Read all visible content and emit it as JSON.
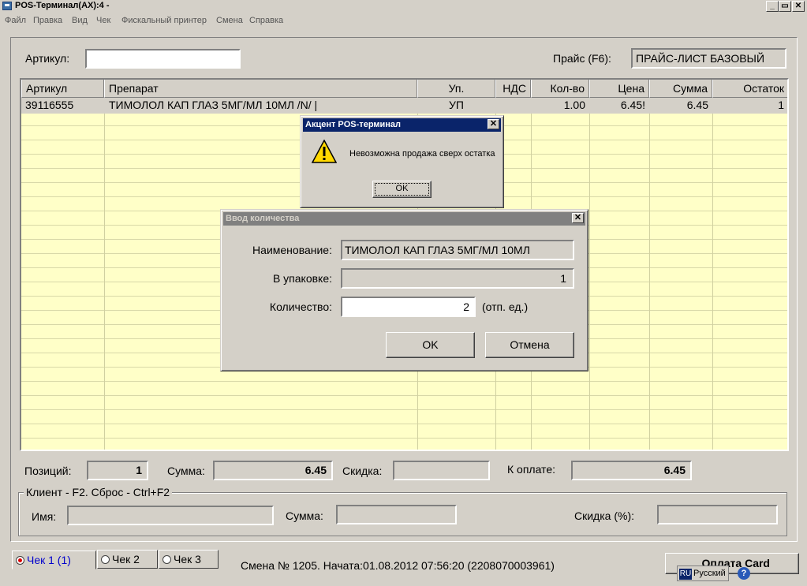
{
  "window": {
    "title": "POS-Терминал(AX):4 -",
    "min": "_",
    "max": "▭",
    "close": "✕"
  },
  "menu": [
    "Файл",
    "Правка",
    "Вид",
    "Чек",
    "Фискальный принтер",
    "Смена",
    "Справка"
  ],
  "top": {
    "article_label": "Артикул:",
    "article_value": "",
    "price_label": "Прайс (F6):",
    "price_value": "ПРАЙС-ЛИСТ БАЗОВЫЙ"
  },
  "grid": {
    "columns": [
      "Артикул",
      "Препарат",
      "Уп.",
      "НДС",
      "Кол-во",
      "Цена",
      "Сумма",
      "Остаток"
    ],
    "rows": [
      [
        "39116555",
        "ТИМОЛОЛ КАП ГЛАЗ 5МГ/МЛ 10МЛ  /N/ |",
        "УП",
        "",
        "1.00",
        "6.45!",
        "6.45",
        "1"
      ]
    ]
  },
  "totals": {
    "positions_label": "Позиций:",
    "positions_value": "1",
    "sum_label": "Сумма:",
    "sum_value": "6.45",
    "discount_label": "Скидка:",
    "discount_value": "",
    "topay_label": "К оплате:",
    "topay_value": "6.45"
  },
  "client": {
    "legend": "Клиент - F2. Сброс - Ctrl+F2",
    "name_label": "Имя:",
    "name_value": "",
    "sum_label": "Сумма:",
    "sum_value": "",
    "discount_label": "Скидка (%):",
    "discount_value": ""
  },
  "tabs": [
    "Чек 1 (1)",
    "Чек 2",
    "Чек 3"
  ],
  "status": {
    "shift": "Смена № 1205. Начата:01.08.2012 07:56:20 (2208070003961)",
    "right_button": "Оплата Card",
    "lang_code": "RU",
    "lang_name": "Русский",
    "help": "?"
  },
  "alert": {
    "title": "Акцент POS-терминал",
    "message": "Невозможна продажа сверх остатка",
    "ok": "OK",
    "close": "✕",
    "icon": "warning-icon"
  },
  "qty_dialog": {
    "title": "Ввод количества",
    "close": "✕",
    "name_label": "Наименование:",
    "name_value": "ТИМОЛОЛ КАП ГЛАЗ 5МГ/МЛ 10МЛ",
    "pack_label": "В упаковке:",
    "pack_value": "1",
    "qty_label": "Количество:",
    "qty_value": "2",
    "unit": "(отп. ед.)",
    "ok": "OK",
    "cancel": "Отмена"
  }
}
